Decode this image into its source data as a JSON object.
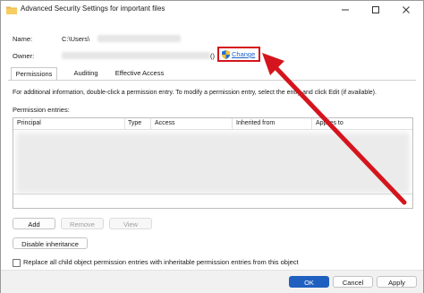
{
  "window": {
    "title": "Advanced Security Settings for important files",
    "minimize_icon": "minimize-icon",
    "maximize_icon": "maximize-icon",
    "close_icon": "close-icon"
  },
  "fields": {
    "name_label": "Name:",
    "name_value": "C:\\Users\\",
    "owner_label": "Owner:",
    "owner_suffix": "()",
    "change_link": "Change"
  },
  "tabs": [
    {
      "label": "Permissions",
      "active": true
    },
    {
      "label": "Auditing",
      "active": false
    },
    {
      "label": "Effective Access",
      "active": false
    }
  ],
  "permissions": {
    "info_text": "For additional information, double-click a permission entry. To modify a permission entry, select the entry and click Edit (if available).",
    "entries_label": "Permission entries:",
    "columns": [
      "Principal",
      "Type",
      "Access",
      "Inherited from",
      "Applies to"
    ]
  },
  "buttons": {
    "add": "Add",
    "remove": "Remove",
    "view": "View",
    "disable_inheritance": "Disable inheritance",
    "ok": "OK",
    "cancel": "Cancel",
    "apply": "Apply"
  },
  "replace_checkbox_label": "Replace all child object permission entries with inheritable permission entries from this object",
  "colors": {
    "accent": "#1f5fbf",
    "highlight_red": "#d4151d",
    "link": "#1f62c9"
  }
}
